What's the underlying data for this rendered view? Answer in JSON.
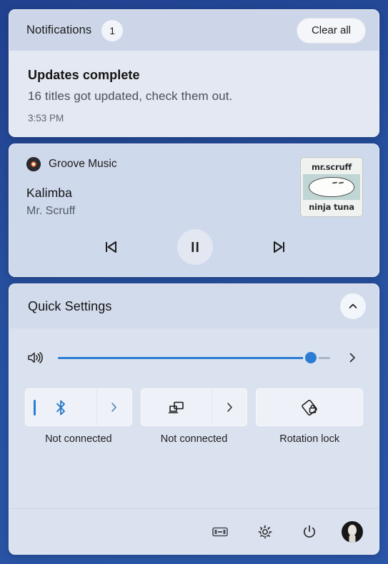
{
  "theme": {
    "desktop_bg": "#21418f",
    "card_bg": "#dde3ef",
    "accent": "#2b7cd3"
  },
  "notifications": {
    "title": "Notifications",
    "count": "1",
    "clear_all_label": "Clear all",
    "items": [
      {
        "heading": "Updates complete",
        "body": "16 titles got updated, check them out.",
        "time": "3:53 PM"
      }
    ]
  },
  "media": {
    "app_name": "Groove Music",
    "app_icon": "vinyl-record-icon",
    "track_title": "Kalimba",
    "artist": "Mr. Scruff",
    "album_art": {
      "top_text": "mr.scruff",
      "bottom_text": "ninja tuna"
    },
    "controls": {
      "previous": "previous-track",
      "play_pause": "pause",
      "next": "next-track"
    }
  },
  "quick_settings": {
    "title": "Quick Settings",
    "collapse_icon": "chevron-up-icon",
    "volume": {
      "icon": "volume-icon",
      "value": 93,
      "expand_icon": "chevron-right-icon"
    },
    "tiles": [
      {
        "name": "bluetooth",
        "icon": "bluetooth-icon",
        "label": "Not connected",
        "has_chevron": true,
        "active_bar": true
      },
      {
        "name": "cast",
        "icon": "cast-icon",
        "label": "Not connected",
        "has_chevron": true,
        "active_bar": false
      },
      {
        "name": "rotation-lock",
        "icon": "rotation-lock-icon",
        "label": "Rotation lock",
        "has_chevron": false,
        "active_bar": false
      }
    ],
    "footer": [
      {
        "name": "battery",
        "icon": "battery-icon"
      },
      {
        "name": "settings",
        "icon": "gear-icon"
      },
      {
        "name": "power",
        "icon": "power-icon"
      },
      {
        "name": "account",
        "icon": "user-avatar"
      }
    ]
  }
}
